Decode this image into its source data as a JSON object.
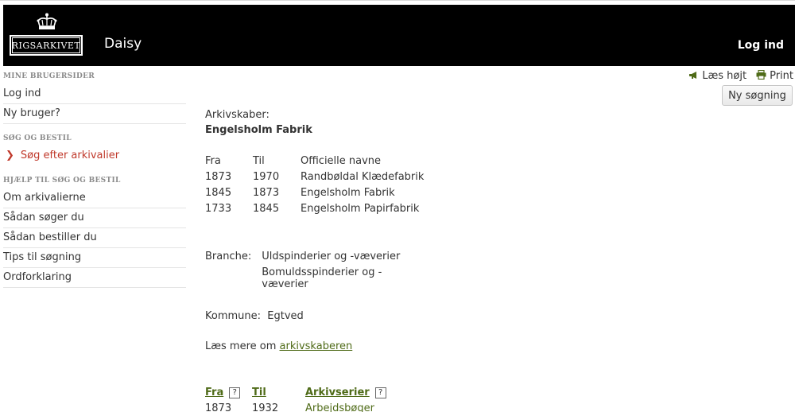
{
  "header": {
    "logo_text": "RIGSARKIVET",
    "app_title": "Daisy",
    "login_label": "Log ind"
  },
  "sidebar": {
    "section1_heading": "MINE BRUGERSIDER",
    "section1_items": [
      "Log ind",
      "Ny bruger?"
    ],
    "section2_heading": "SØG OG BESTIL",
    "section2_items": [
      "Søg efter arkivalier"
    ],
    "section3_heading": "HJÆLP TIL SØG OG BESTIL",
    "section3_items": [
      "Om arkivalierne",
      "Sådan søger du",
      "Sådan bestiller du",
      "Tips til søgning",
      "Ordforklaring"
    ]
  },
  "toolbar": {
    "read_aloud_label": "Læs højt",
    "print_label": "Print",
    "new_search_label": "Ny søgning"
  },
  "creator": {
    "label": "Arkivskaber:",
    "name": "Engelsholm Fabrik",
    "names_table": {
      "headers": [
        "Fra",
        "Til",
        "Officielle navne"
      ],
      "rows": [
        [
          "1873",
          "1970",
          "Randbøldal Klædefabrik"
        ],
        [
          "1845",
          "1873",
          "Engelsholm Fabrik"
        ],
        [
          "1733",
          "1845",
          "Engelsholm Papirfabrik"
        ]
      ]
    },
    "branche_label": "Branche:",
    "branche_values": [
      "Uldspinderier og -væverier",
      "Bomuldsspinderier og -væverier"
    ],
    "kommune_label": "Kommune:",
    "kommune_value": "Egtved",
    "read_more_prefix": "Læs mere om ",
    "read_more_link": "arkivskaberen"
  },
  "series": {
    "headers": [
      "Fra",
      "Til",
      "Arkivserier"
    ],
    "help_glyph": "?",
    "rows": [
      [
        "1873",
        "1932",
        "Arbejdsbøger"
      ]
    ]
  }
}
